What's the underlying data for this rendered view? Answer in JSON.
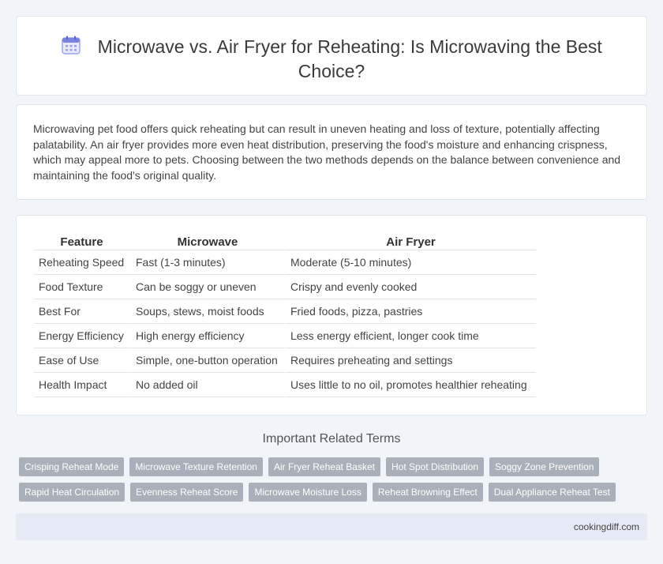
{
  "header": {
    "icon": "calendar-icon",
    "title": "Microwave vs. Air Fryer for Reheating: Is Microwaving the Best Choice?"
  },
  "intro": {
    "text": "Microwaving pet food offers quick reheating but can result in uneven heating and loss of texture, potentially affecting palatability. An air fryer provides more even heat distribution, preserving the food's moisture and enhancing crispness, which may appeal more to pets. Choosing between the two methods depends on the balance between convenience and maintaining the food's original quality."
  },
  "table": {
    "headers": [
      "Feature",
      "Microwave",
      "Air Fryer"
    ],
    "rows": [
      [
        "Reheating Speed",
        "Fast (1-3 minutes)",
        "Moderate (5-10 minutes)"
      ],
      [
        "Food Texture",
        "Can be soggy or uneven",
        "Crispy and evenly cooked"
      ],
      [
        "Best For",
        "Soups, stews, moist foods",
        "Fried foods, pizza, pastries"
      ],
      [
        "Energy Efficiency",
        "High energy efficiency",
        "Less energy efficient, longer cook time"
      ],
      [
        "Ease of Use",
        "Simple, one-button operation",
        "Requires preheating and settings"
      ],
      [
        "Health Impact",
        "No added oil",
        "Uses little to no oil, promotes healthier reheating"
      ]
    ]
  },
  "related": {
    "title": "Important Related Terms",
    "rows": [
      [
        "Crisping Reheat Mode",
        "Microwave Texture Retention",
        "Air Fryer Reheat Basket",
        "Hot Spot Distribution",
        "Soggy Zone Prevention"
      ],
      [
        "Rapid Heat Circulation",
        "Evenness Reheat Score",
        "Microwave Moisture Loss",
        "Reheat Browning Effect",
        "Dual Appliance Reheat Test"
      ]
    ]
  },
  "footer": {
    "site": "cookingdiff.com"
  },
  "colors": {
    "background": "#f1f4f9",
    "tag": "#a9b0ba",
    "footer": "#e5eaf5",
    "icon_accent": "#7b83e0"
  }
}
